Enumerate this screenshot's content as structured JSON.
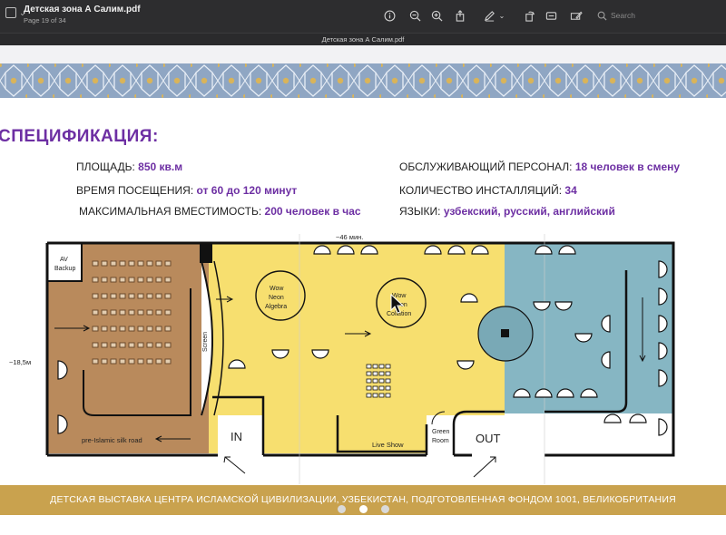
{
  "toolbar": {
    "doc_title": "Детская зона А Салим.pdf",
    "page_info": "Page 19 of 34",
    "search_placeholder": "Search"
  },
  "tab": {
    "title": "Детская зона А Салим.pdf"
  },
  "slide": {
    "heading": "СПЕЦИФИКАЦИЯ:",
    "specs": [
      {
        "label": "ПЛОЩАДЬ:",
        "value": "850 кв.м"
      },
      {
        "label": "ВРЕМЯ ПОСЕЩЕНИЯ:",
        "value": "от 60 до 120 минут"
      },
      {
        "label": "МАКСИМАЛЬНАЯ ВМЕСТИМОСТЬ:",
        "value": "200 человек в час"
      },
      {
        "label": "ОБСЛУЖИВАЮЩИЙ ПЕРСОНАЛ:",
        "value": "18 человек в смену"
      },
      {
        "label": "КОЛИЧЕСТВО ИНСТАЛЛЯЦИЙ:",
        "value": "34"
      },
      {
        "label": "ЯЗЫКИ:",
        "value": "узбекский, русский, английский"
      }
    ],
    "footer": "ДЕТСКАЯ ВЫСТАВКА ЦЕНТРА ИСЛАМСКОЙ ЦИВИЛИЗАЦИИ, УЗБЕКИСТАН, ПОДГОТОВЛЕННАЯ ФОНДОМ 1001, ВЕЛИКОБРИТАНИЯ",
    "current_dot": 2
  },
  "plan": {
    "width_dim": "~46 мин.",
    "height_dim": "~18,5м",
    "labels": {
      "av_backup_1": "AV",
      "av_backup_2": "Backup",
      "screen": "Screen",
      "algebra_1": "Wow",
      "algebra_2": "Neon",
      "algebra_3": "Algebra",
      "installation_1": "Wow",
      "installation_2": "Neon",
      "installation_3": "Collation",
      "silk_road": "pre-Islamic silk road",
      "entry": "IN",
      "live_show": "Live Show",
      "green_room_1": "Green",
      "green_room_2": "Room",
      "exit": "OUT"
    },
    "colors": {
      "brown": "#b98a5c",
      "yellow": "#f7df6f",
      "teal": "#86b6c3"
    }
  }
}
